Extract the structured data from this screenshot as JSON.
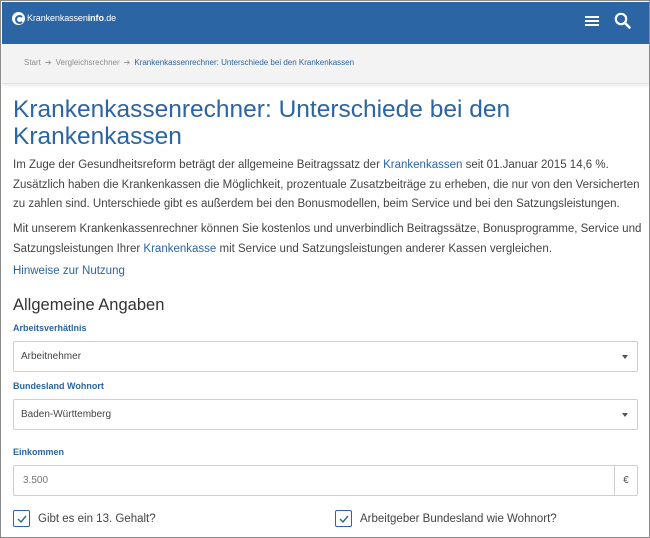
{
  "header": {
    "logo_text": "Krankenkassen",
    "logo_bold": "info",
    "logo_suffix": ".de",
    "brand_color": "#2b65a3"
  },
  "breadcrumb": {
    "items": [
      "Start",
      "Vergleichsrechner",
      "Krankenkassenrechner: Unterschiede bei den Krankenkassen"
    ]
  },
  "page": {
    "title": "Krankenkassenrechner: Unterschiede bei den Krankenkassen",
    "intro1_a": "Im Zuge der Gesundheitsreform beträgt der allgemeine Beitragssatz der ",
    "intro1_link": "Krankenkassen",
    "intro1_b": " seit 01.Januar 2015 14,6 %. Zusätzlich haben die Krankenkassen die Möglichkeit, prozentuale Zusatzbeiträge zu erheben, die nur von den Versicherten zu zahlen sind. Unterschiede gibt es außerdem bei den Bonusmodellen, beim Service und bei den Satzungsleistungen.",
    "intro2_a": "Mit unserem Krankenkassenrechner können Sie kostenlos und unverbindlich Beitragssätze, Bonusprogramme, Service und Satzungsleistungen Ihrer ",
    "intro2_link": "Krankenkasse",
    "intro2_b": " mit Service und Satzungsleistungen anderer Kassen vergleichen.",
    "hint_link": "Hinweise zur Nutzung"
  },
  "form": {
    "section_title": "Allgemeine Angaben",
    "employment_label": "Arbeitsverhätlnis",
    "employment_value": "Arbeitnehmer",
    "state_label": "Bundesland Wohnort",
    "state_value": "Baden-Württemberg",
    "income_label": "Einkommen",
    "income_placeholder": "3.500",
    "currency": "€",
    "check_13th": "Gibt es ein 13. Gehalt?",
    "check_employer_state": "Arbeitgeber Bundesland wie Wohnort?"
  }
}
